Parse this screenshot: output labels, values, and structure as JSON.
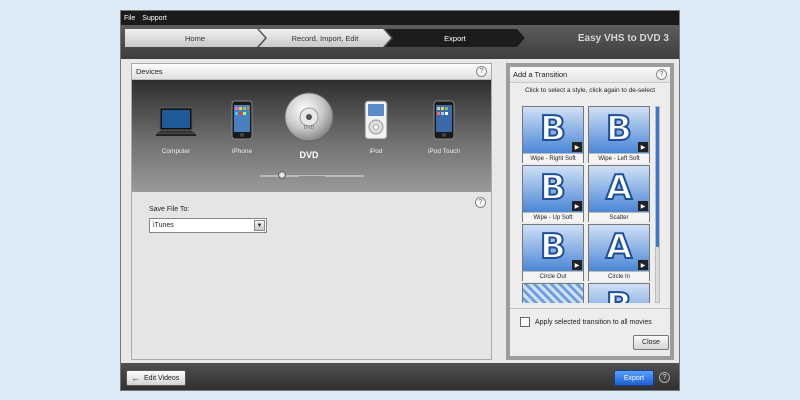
{
  "menu": {
    "file": "File",
    "support": "Support"
  },
  "steps": [
    {
      "label": "Home"
    },
    {
      "label": "Record, Import, Edit"
    },
    {
      "label": "Export"
    }
  ],
  "brand": "Easy VHS to DVD 3",
  "devices": {
    "title": "Devices",
    "help": "?",
    "items": [
      {
        "label": "Computer",
        "icon": "laptop-icon"
      },
      {
        "label": "iPhone",
        "icon": "iphone-icon"
      },
      {
        "label": "DVD",
        "icon": "dvd-disc-icon",
        "selected": true
      },
      {
        "label": "iPod",
        "icon": "ipod-icon"
      },
      {
        "label": "iPod Touch",
        "icon": "ipod-touch-icon"
      }
    ]
  },
  "save": {
    "label": "Save File To:",
    "value": "iTunes",
    "help": "?"
  },
  "transitions": {
    "title": "Add a Transition",
    "help": "?",
    "subtitle": "Click to select a style, click again to de-select",
    "items": [
      {
        "label": "Wipe - Right Soft",
        "letter": "B"
      },
      {
        "label": "Wipe - Left Soft",
        "letter": "B"
      },
      {
        "label": "Wipe - Up Soft",
        "letter": "B"
      },
      {
        "label": "Scatter",
        "letter": "A"
      },
      {
        "label": "Circle Out",
        "letter": "B"
      },
      {
        "label": "Circle In",
        "letter": "A"
      },
      {
        "label": "",
        "letter": ""
      },
      {
        "label": "",
        "letter": "B"
      }
    ],
    "apply_all": "Apply selected transition to all movies",
    "close": "Close"
  },
  "bottom": {
    "edit_videos": "Edit Videos",
    "export": "Export",
    "help": "?"
  },
  "colors": {
    "accent": "#2d6fe0",
    "dark": "#1c1c1c"
  }
}
